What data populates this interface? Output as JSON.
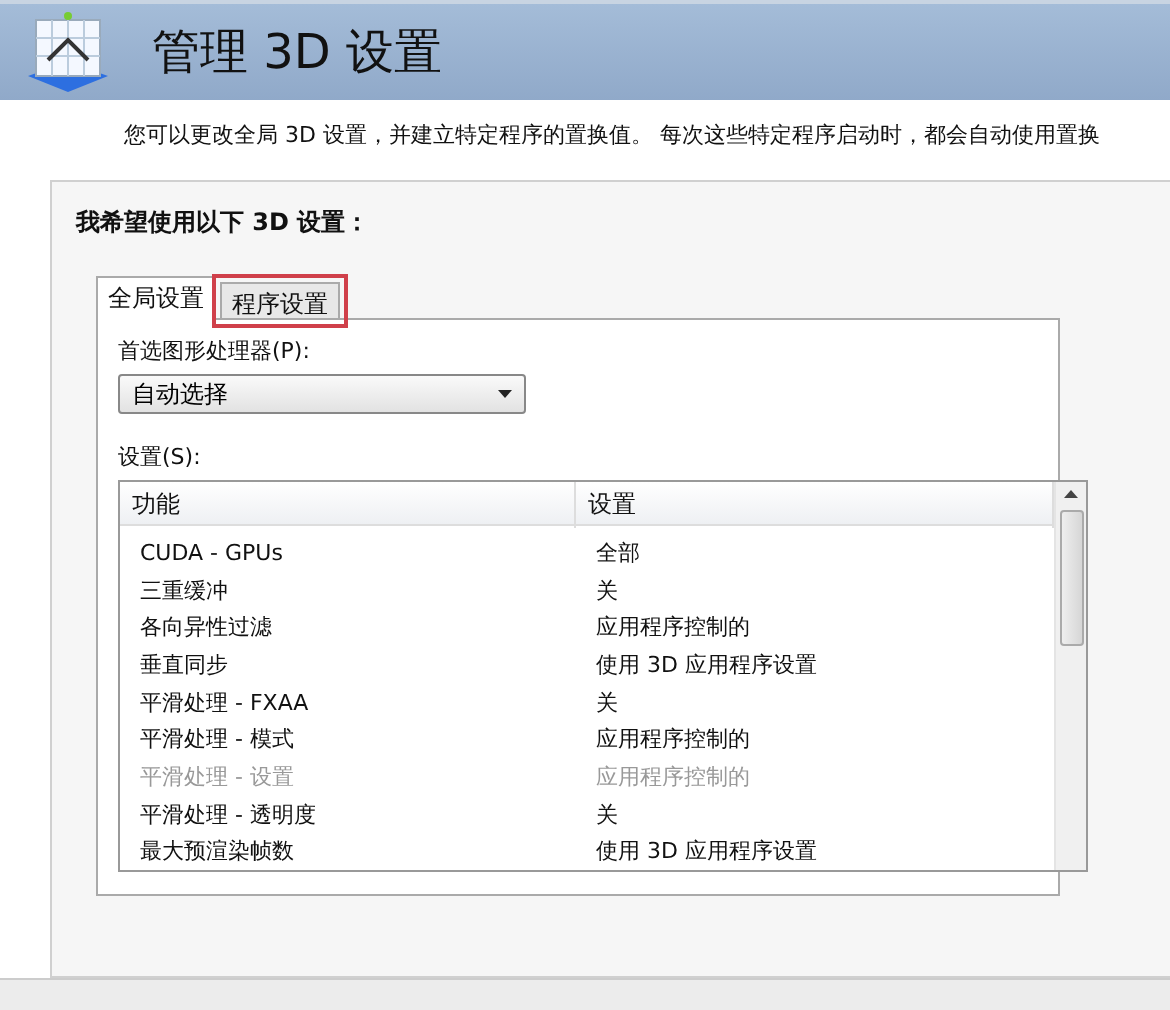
{
  "header": {
    "title": "管理 3D 设置"
  },
  "description": "您可以更改全局 3D 设置，并建立特定程序的置换值。 每次这些特定程序启动时，都会自动使用置换",
  "panel": {
    "title": "我希望使用以下 3D 设置：",
    "tabs": [
      {
        "label": "全局设置",
        "selected": true,
        "highlighted": false
      },
      {
        "label": "程序设置",
        "selected": false,
        "highlighted": true
      }
    ],
    "processor_label": "首选图形处理器(P):",
    "processor_value": "自动选择",
    "settings_label": "设置(S):",
    "table": {
      "columns": [
        "功能",
        "设置"
      ],
      "rows": [
        {
          "feature": "CUDA - GPUs",
          "value": "全部",
          "disabled": false
        },
        {
          "feature": "三重缓冲",
          "value": "关",
          "disabled": false
        },
        {
          "feature": "各向异性过滤",
          "value": "应用程序控制的",
          "disabled": false
        },
        {
          "feature": "垂直同步",
          "value": "使用 3D 应用程序设置",
          "disabled": false
        },
        {
          "feature": "平滑处理 - FXAA",
          "value": "关",
          "disabled": false
        },
        {
          "feature": "平滑处理 - 模式",
          "value": "应用程序控制的",
          "disabled": false
        },
        {
          "feature": "平滑处理 - 设置",
          "value": "应用程序控制的",
          "disabled": true
        },
        {
          "feature": "平滑处理 - 透明度",
          "value": "关",
          "disabled": false
        },
        {
          "feature": "最大预渲染帧数",
          "value": "使用 3D 应用程序设置",
          "disabled": false
        }
      ]
    }
  }
}
